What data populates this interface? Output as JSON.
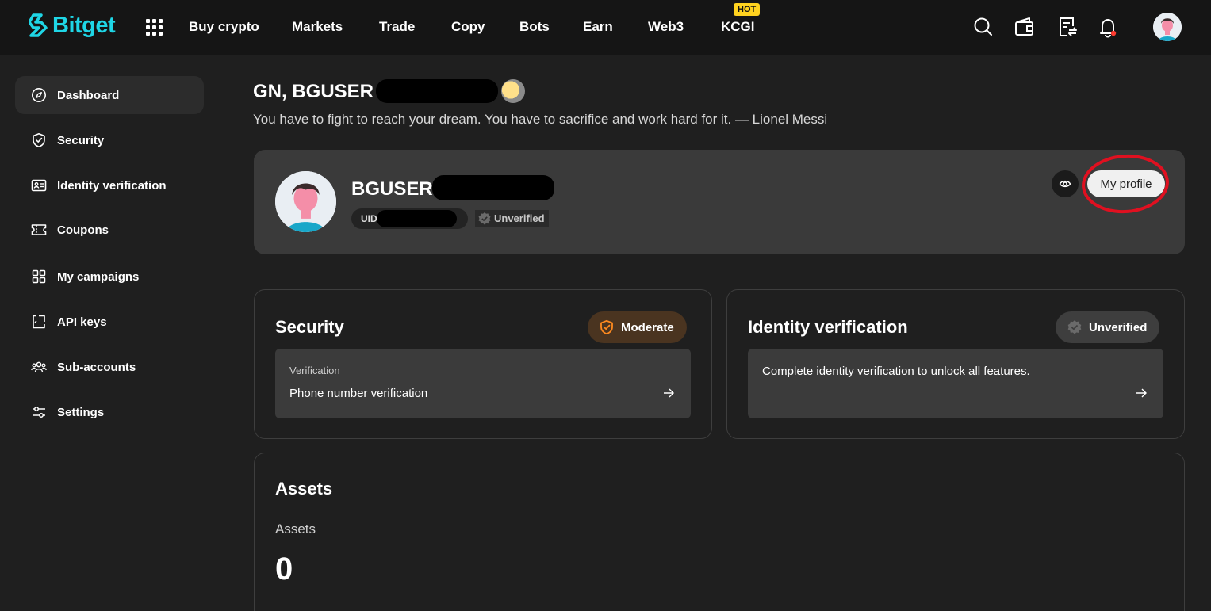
{
  "brand": {
    "name": "Bitget",
    "accent": "#1fd6e6"
  },
  "nav": {
    "items": [
      {
        "label": "Buy crypto"
      },
      {
        "label": "Markets"
      },
      {
        "label": "Trade"
      },
      {
        "label": "Copy"
      },
      {
        "label": "Bots"
      },
      {
        "label": "Earn"
      },
      {
        "label": "Web3"
      },
      {
        "label": "KCGI"
      }
    ],
    "hot_badge": "HOT"
  },
  "sidebar": {
    "items": [
      {
        "label": "Dashboard",
        "icon": "compass-icon",
        "active": true
      },
      {
        "label": "Security",
        "icon": "shield-check-icon"
      },
      {
        "label": "Identity verification",
        "icon": "id-card-icon"
      },
      {
        "label": "Coupons",
        "icon": "ticket-icon"
      },
      {
        "label": "My campaigns",
        "icon": "grid-icon"
      },
      {
        "label": "API keys",
        "icon": "api-key-icon"
      },
      {
        "label": "Sub-accounts",
        "icon": "users-icon"
      },
      {
        "label": "Settings",
        "icon": "sliders-icon"
      }
    ]
  },
  "greeting": {
    "title": "GN, BGUSER",
    "quote": "You have to fight to reach your dream. You have to sacrifice and work hard for it. — Lionel Messi"
  },
  "profile": {
    "name": "BGUSER",
    "uid_label": "UID",
    "status": "Unverified",
    "my_profile_label": "My profile"
  },
  "security_card": {
    "title": "Security",
    "badge": "Moderate",
    "badge_color": "#ff8a1f",
    "item_label": "Verification",
    "item_text": "Phone number verification"
  },
  "identity_card": {
    "title": "Identity verification",
    "badge": "Unverified",
    "item_text": "Complete identity verification to unlock all features."
  },
  "assets": {
    "title": "Assets",
    "label": "Assets",
    "value": "0"
  }
}
